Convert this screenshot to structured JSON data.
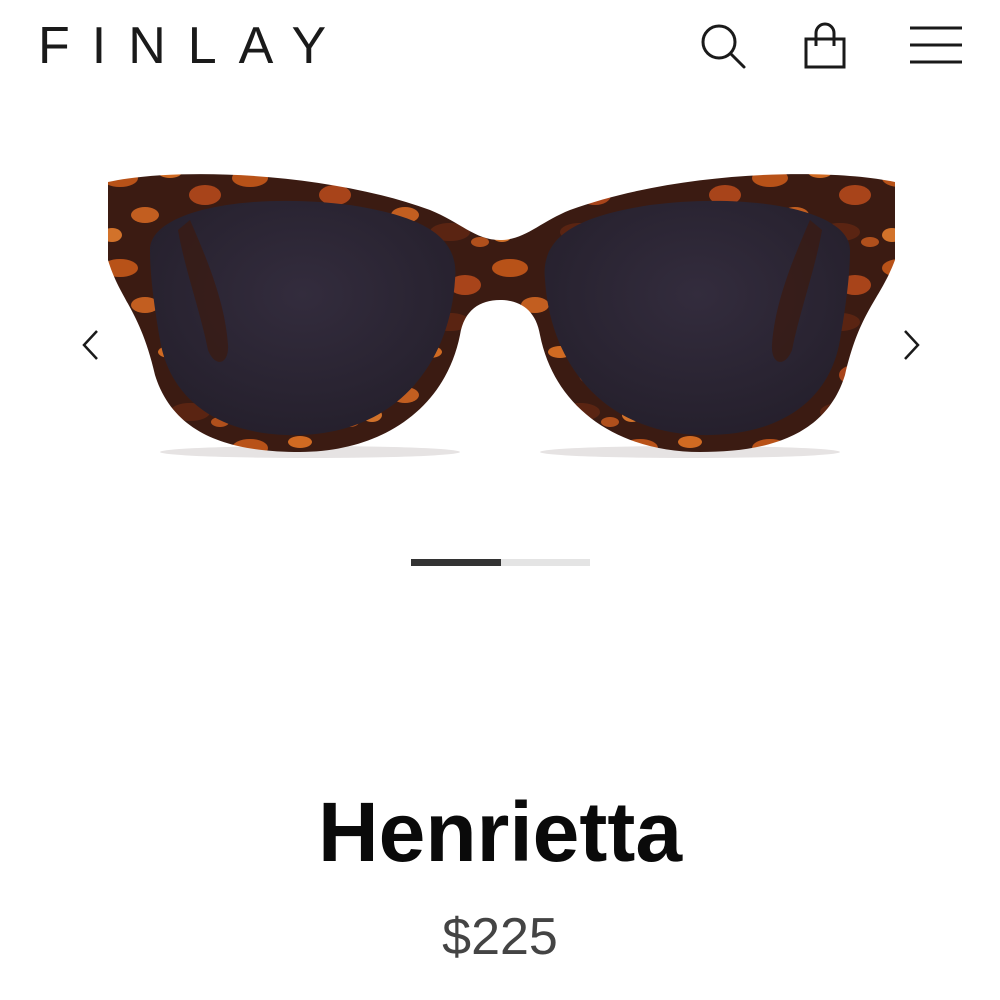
{
  "header": {
    "logo": "FINLAY",
    "icons": {
      "search": "search-icon",
      "bag": "shopping-bag-icon",
      "menu": "hamburger-menu-icon"
    }
  },
  "carousel": {
    "prev_icon": "chevron-left-icon",
    "next_icon": "chevron-right-icon",
    "image": "tortoiseshell cat-eye sunglasses",
    "progress": 0.5
  },
  "product": {
    "name": "Henrietta",
    "price": "$225"
  },
  "colors": {
    "text": "#0a0a0a",
    "price": "#444444",
    "progress_fill": "#333333",
    "progress_track": "#e4e4e4",
    "tortoise_dark": "#3a1a12",
    "tortoise_amber": "#c0591b",
    "lens": "#2e2838"
  }
}
